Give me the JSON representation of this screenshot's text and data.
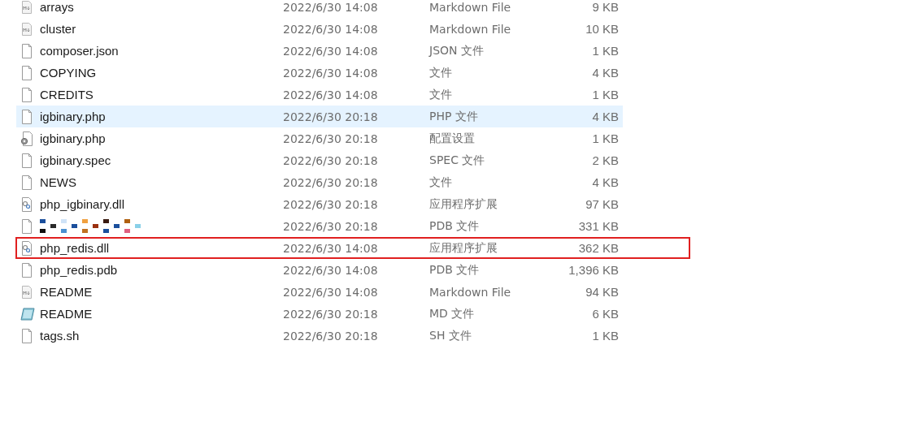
{
  "files": [
    {
      "name": "arrays",
      "date": "2022/6/30 14:08",
      "type": "Markdown File",
      "size": "9 KB",
      "kind": "markdown",
      "selected": false,
      "highlighted": false
    },
    {
      "name": "cluster",
      "date": "2022/6/30 14:08",
      "type": "Markdown File",
      "size": "10 KB",
      "kind": "markdown",
      "selected": false,
      "highlighted": false
    },
    {
      "name": "composer.json",
      "date": "2022/6/30 14:08",
      "type": "JSON 文件",
      "size": "1 KB",
      "kind": "file",
      "selected": false,
      "highlighted": false
    },
    {
      "name": "COPYING",
      "date": "2022/6/30 14:08",
      "type": "文件",
      "size": "4 KB",
      "kind": "file",
      "selected": false,
      "highlighted": false
    },
    {
      "name": "CREDITS",
      "date": "2022/6/30 14:08",
      "type": "文件",
      "size": "1 KB",
      "kind": "file",
      "selected": false,
      "highlighted": false
    },
    {
      "name": "igbinary.php",
      "date": "2022/6/30 20:18",
      "type": "PHP 文件",
      "size": "4 KB",
      "kind": "file",
      "selected": true,
      "highlighted": false
    },
    {
      "name": "igbinary.php",
      "date": "2022/6/30 20:18",
      "type": "配置设置",
      "size": "1 KB",
      "kind": "settings",
      "selected": false,
      "highlighted": false
    },
    {
      "name": "igbinary.spec",
      "date": "2022/6/30 20:18",
      "type": "SPEC 文件",
      "size": "2 KB",
      "kind": "file",
      "selected": false,
      "highlighted": false
    },
    {
      "name": "NEWS",
      "date": "2022/6/30 20:18",
      "type": "文件",
      "size": "4 KB",
      "kind": "file",
      "selected": false,
      "highlighted": false
    },
    {
      "name": "php_igbinary.dll",
      "date": "2022/6/30 20:18",
      "type": "应用程序扩展",
      "size": "97 KB",
      "kind": "extension",
      "selected": false,
      "highlighted": false
    },
    {
      "date": "2022/6/30 20:18",
      "type": "PDB 文件",
      "size": "331 KB",
      "kind": "file",
      "selected": false,
      "highlighted": false
    },
    {
      "name": "php_redis.dll",
      "date": "2022/6/30 14:08",
      "type": "应用程序扩展",
      "size": "362 KB",
      "kind": "extension",
      "selected": false,
      "highlighted": true
    },
    {
      "name": "php_redis.pdb",
      "date": "2022/6/30 14:08",
      "type": "PDB 文件",
      "size": "1,396 KB",
      "kind": "file",
      "selected": false,
      "highlighted": false
    },
    {
      "name": "README",
      "date": "2022/6/30 14:08",
      "type": "Markdown File",
      "size": "94 KB",
      "kind": "markdown",
      "selected": false,
      "highlighted": false
    },
    {
      "name": "README",
      "date": "2022/6/30 20:18",
      "type": "MD 文件",
      "size": "6 KB",
      "kind": "notebook",
      "selected": false,
      "highlighted": false
    },
    {
      "name": "tags.sh",
      "date": "2022/6/30 20:18",
      "type": "SH 文件",
      "size": "1 KB",
      "kind": "file",
      "selected": false,
      "highlighted": false
    }
  ]
}
